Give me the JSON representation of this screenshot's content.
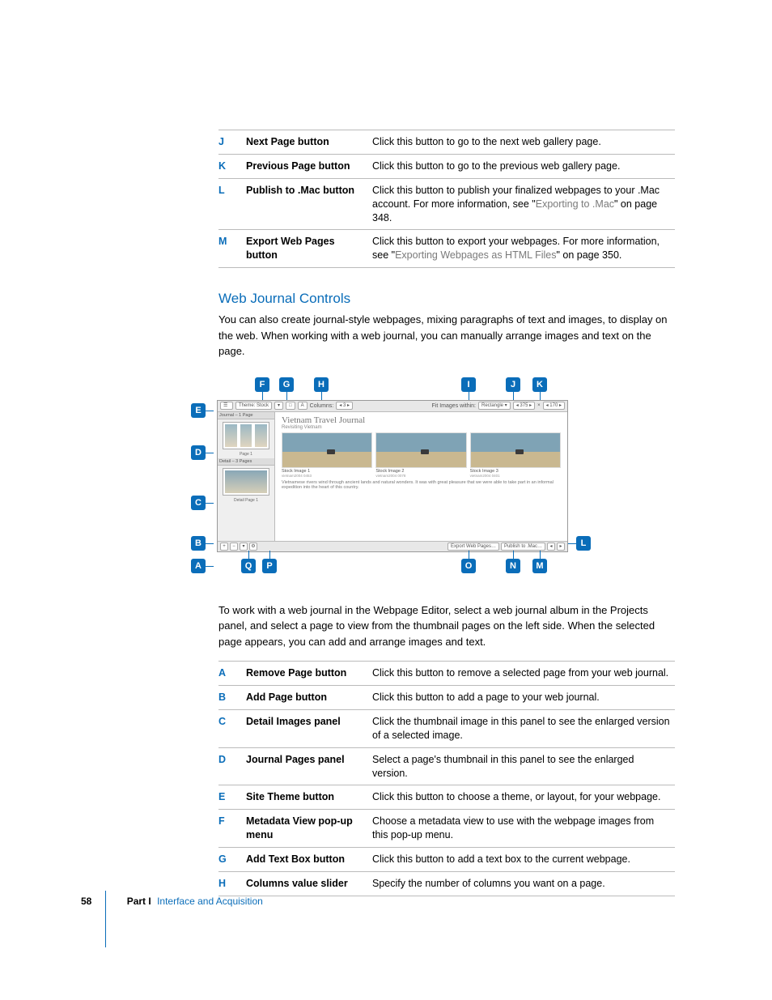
{
  "table1": [
    {
      "letter": "J",
      "name": "Next Page button",
      "desc": "Click this button to go to the next web gallery page."
    },
    {
      "letter": "K",
      "name": "Previous Page button",
      "desc": "Click this button to go to the previous web gallery page."
    },
    {
      "letter": "L",
      "name": "Publish to .Mac button",
      "desc": "Click this button to publish your finalized webpages to your .Mac account. For more information, see \"",
      "link": "Exporting to .Mac",
      "desc2": "\" on page 348."
    },
    {
      "letter": "M",
      "name": "Export Web Pages button",
      "desc": "Click this button to export your webpages. For more information, see \"",
      "link": "Exporting Webpages as HTML Files",
      "desc2": "\" on page 350."
    }
  ],
  "section_title": "Web Journal Controls",
  "para1": "You can also create journal-style webpages, mixing paragraphs of text and images, to display on the web. When working with a web journal, you can manually arrange images and text on the page.",
  "para2": "To work with a web journal in the Webpage Editor, select a web journal album in the Projects panel, and select a page to view from the thumbnail pages on the left side. When the selected page appears, you can add and arrange images and text.",
  "table2": [
    {
      "letter": "A",
      "name": "Remove Page button",
      "desc": "Click this button to remove a selected page from your web journal."
    },
    {
      "letter": "B",
      "name": "Add Page button",
      "desc": "Click this button to add a page to your web journal."
    },
    {
      "letter": "C",
      "name": "Detail Images panel",
      "desc": "Click the thumbnail image in this panel to see the enlarged version of a selected image."
    },
    {
      "letter": "D",
      "name": "Journal Pages panel",
      "desc": "Select a page's thumbnail in this panel to see the enlarged version."
    },
    {
      "letter": "E",
      "name": "Site Theme button",
      "desc": "Click this button to choose a theme, or layout, for your webpage."
    },
    {
      "letter": "F",
      "name": "Metadata View pop-up menu",
      "desc": "Choose a metadata view to use with the webpage images from this pop-up menu."
    },
    {
      "letter": "G",
      "name": "Add Text Box button",
      "desc": "Click this button to add a text box to the current webpage."
    },
    {
      "letter": "H",
      "name": "Columns value slider",
      "desc": "Specify the number of columns you want on a page."
    }
  ],
  "figure": {
    "toolbar": {
      "theme": "Theme: Stock",
      "columns_label": "Columns:",
      "columns_val": "3",
      "fit_label": "Fit Images within:",
      "fit_val": "Rectangle",
      "w": "375",
      "h": "170"
    },
    "side": {
      "journal_head": "Journal – 1 Page",
      "journal_label": "Page 1",
      "detail_head": "Detail – 3 Pages",
      "detail_label": "Detail Page 1"
    },
    "main": {
      "title": "Vietnam Travel Journal",
      "subtitle": "Revisiting Vietnam",
      "cards": [
        {
          "cap": "Stock Image 1",
          "cap2": "vietnam2004 0453"
        },
        {
          "cap": "Stock Image 2",
          "cap2": "vietnam2004 0078"
        },
        {
          "cap": "Stock Image 3",
          "cap2": "vietnam2004 0401"
        }
      ],
      "body": "Vietnamese rivers wind through ancient lands and natural wonders. It was with great pleasure that we were able to take part in an informal expedition into the heart of this country."
    },
    "footer": {
      "export": "Export Web Pages…",
      "publish": "Publish to .Mac…"
    },
    "callouts_top": [
      "F",
      "G",
      "H",
      "I",
      "J",
      "K"
    ],
    "callouts_left": [
      "E",
      "D",
      "C",
      "B",
      "A"
    ],
    "callouts_bottom": [
      "Q",
      "P",
      "O",
      "N",
      "M"
    ],
    "callouts_right": [
      "L"
    ]
  },
  "footer": {
    "page_num": "58",
    "part_label": "Part I",
    "part_name": "Interface and Acquisition"
  }
}
